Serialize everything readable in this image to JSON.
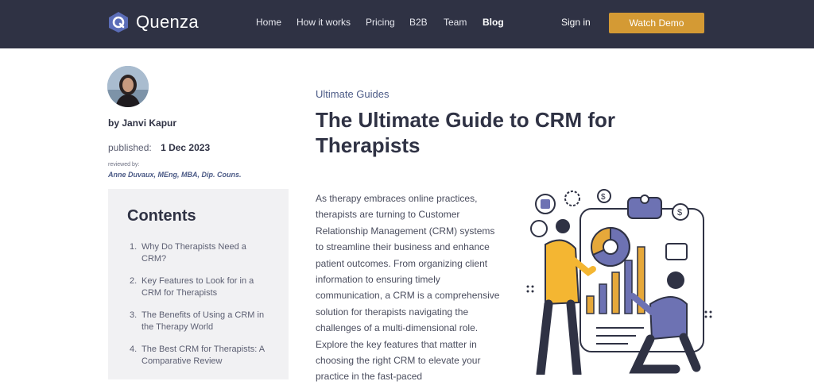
{
  "nav": {
    "brand": "Quenza",
    "links": [
      {
        "label": "Home"
      },
      {
        "label": "How it works"
      },
      {
        "label": "Pricing"
      },
      {
        "label": "B2B"
      },
      {
        "label": "Team"
      },
      {
        "label": "Blog"
      }
    ],
    "signin": "Sign in",
    "demo": "Watch Demo"
  },
  "author": {
    "name": "by Janvi Kapur",
    "published_label": "published:",
    "published_date": "1 Dec 2023",
    "reviewed_label": "reviewed by:",
    "reviewer": "Anne Duvaux, MEng, MBA, Dip. Couns."
  },
  "toc": {
    "title": "Contents",
    "items": [
      {
        "num": "1.",
        "label": "Why Do Therapists Need a CRM?"
      },
      {
        "num": "2.",
        "label": "Key Features to Look for in a CRM for Therapists"
      },
      {
        "num": "3.",
        "label": "The Benefits of Using a CRM in the Therapy World"
      },
      {
        "num": "4.",
        "label": "The Best CRM for Therapists: A Comparative Review"
      }
    ]
  },
  "article": {
    "category": "Ultimate Guides",
    "title": "The Ultimate Guide to CRM for Therapists",
    "intro": "As therapy embraces online practices, therapists are turning to Customer Relationship Management (CRM) systems to streamline their business and enhance patient outcomes. From organizing client information to ensuring timely communication, a CRM is a comprehensive solution for therapists navigating the challenges of a multi-dimensional role. Explore the key features that matter in choosing the right CRM to elevate your practice in the fast-paced"
  },
  "colors": {
    "nav_bg": "#2f3244",
    "accent": "#d49a34",
    "link_blue": "#4b5a86",
    "toc_bg": "#f1f1f3"
  }
}
